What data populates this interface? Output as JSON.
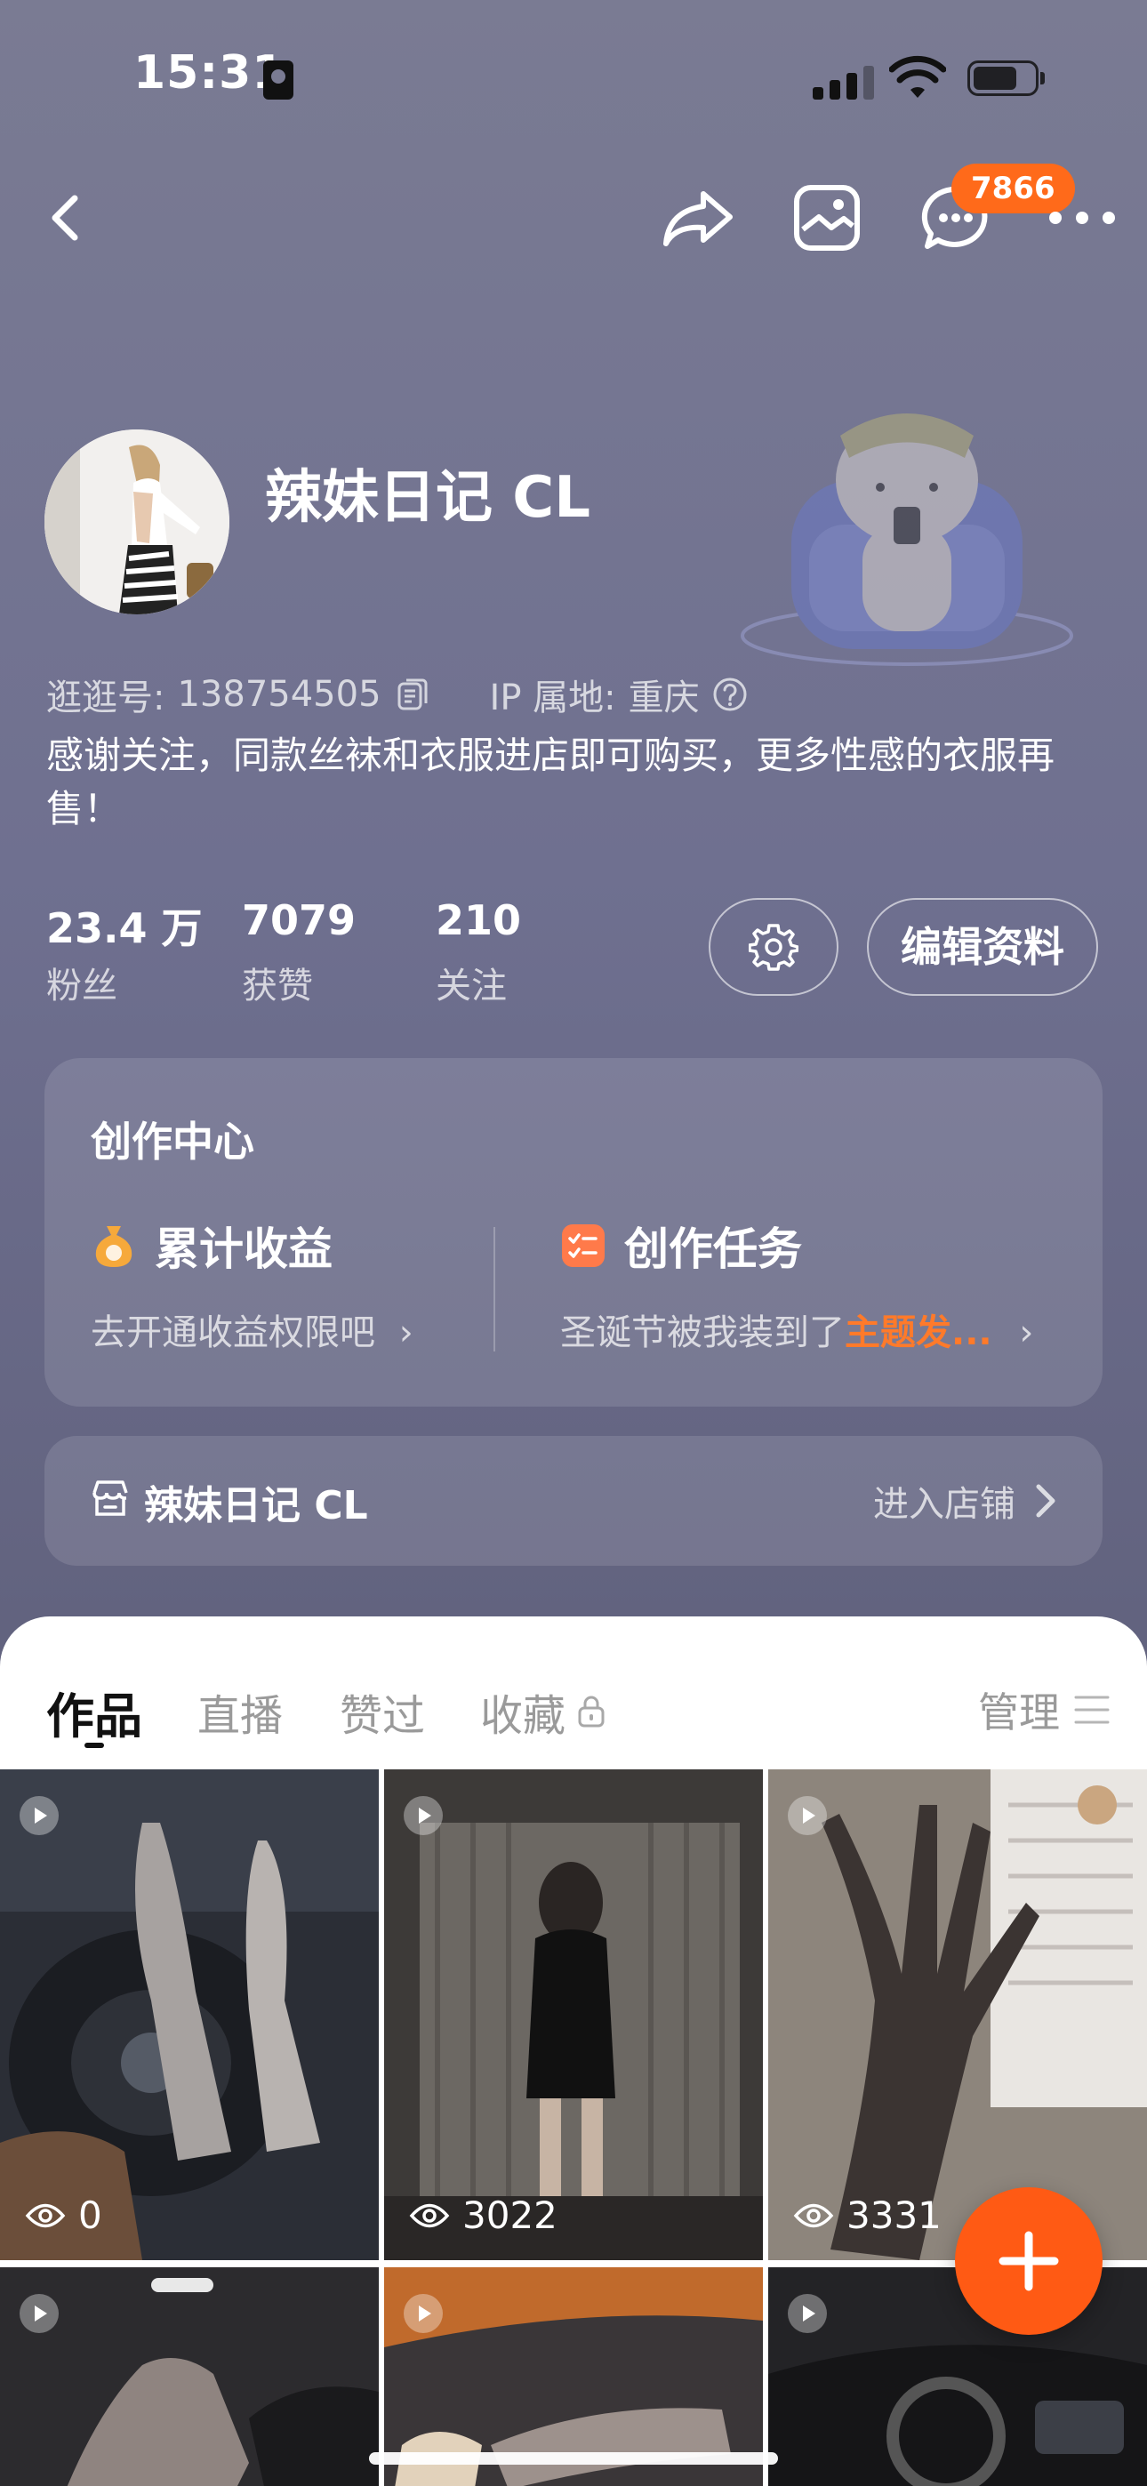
{
  "status_bar": {
    "time": "15:31"
  },
  "nav": {
    "message_badge": "7866"
  },
  "profile": {
    "nickname": "辣妹日记 CL",
    "account_label": "逛逛号:",
    "account_id": "138754505",
    "ip_label": "IP 属地:",
    "ip_location": "重庆",
    "bio": "感谢关注，同款丝袜和衣服进店即可购买，更多性感的衣服再售！"
  },
  "stats": [
    {
      "value": "23.4 万",
      "label": "粉丝"
    },
    {
      "value": "7079",
      "label": "获赞"
    },
    {
      "value": "210",
      "label": "关注"
    }
  ],
  "actions": {
    "edit_profile": "编辑资料"
  },
  "creation_center": {
    "title": "创作中心",
    "earnings": {
      "title": "累计收益",
      "subtitle": "去开通收益权限吧",
      "icon": "money-bag-icon"
    },
    "tasks": {
      "title": "创作任务",
      "subtitle_prefix": "圣诞节被我装到了",
      "subtitle_highlight": "主题发...",
      "icon": "task-list-icon"
    }
  },
  "shop": {
    "name": "辣妹日记 CL",
    "enter_label": "进入店铺"
  },
  "tabs": [
    {
      "label": "作品",
      "active": true
    },
    {
      "label": "直播"
    },
    {
      "label": "赞过"
    },
    {
      "label": "收藏",
      "locked": true
    }
  ],
  "manage_label": "管理",
  "posts": [
    {
      "views": "0"
    },
    {
      "views": "3022"
    },
    {
      "views": "3331"
    },
    {
      "views": ""
    },
    {
      "views": ""
    },
    {
      "views": ""
    }
  ],
  "colors": {
    "accent": "#ff5a14",
    "badge": "#ff6a1a",
    "highlight": "#ff7a2a"
  }
}
